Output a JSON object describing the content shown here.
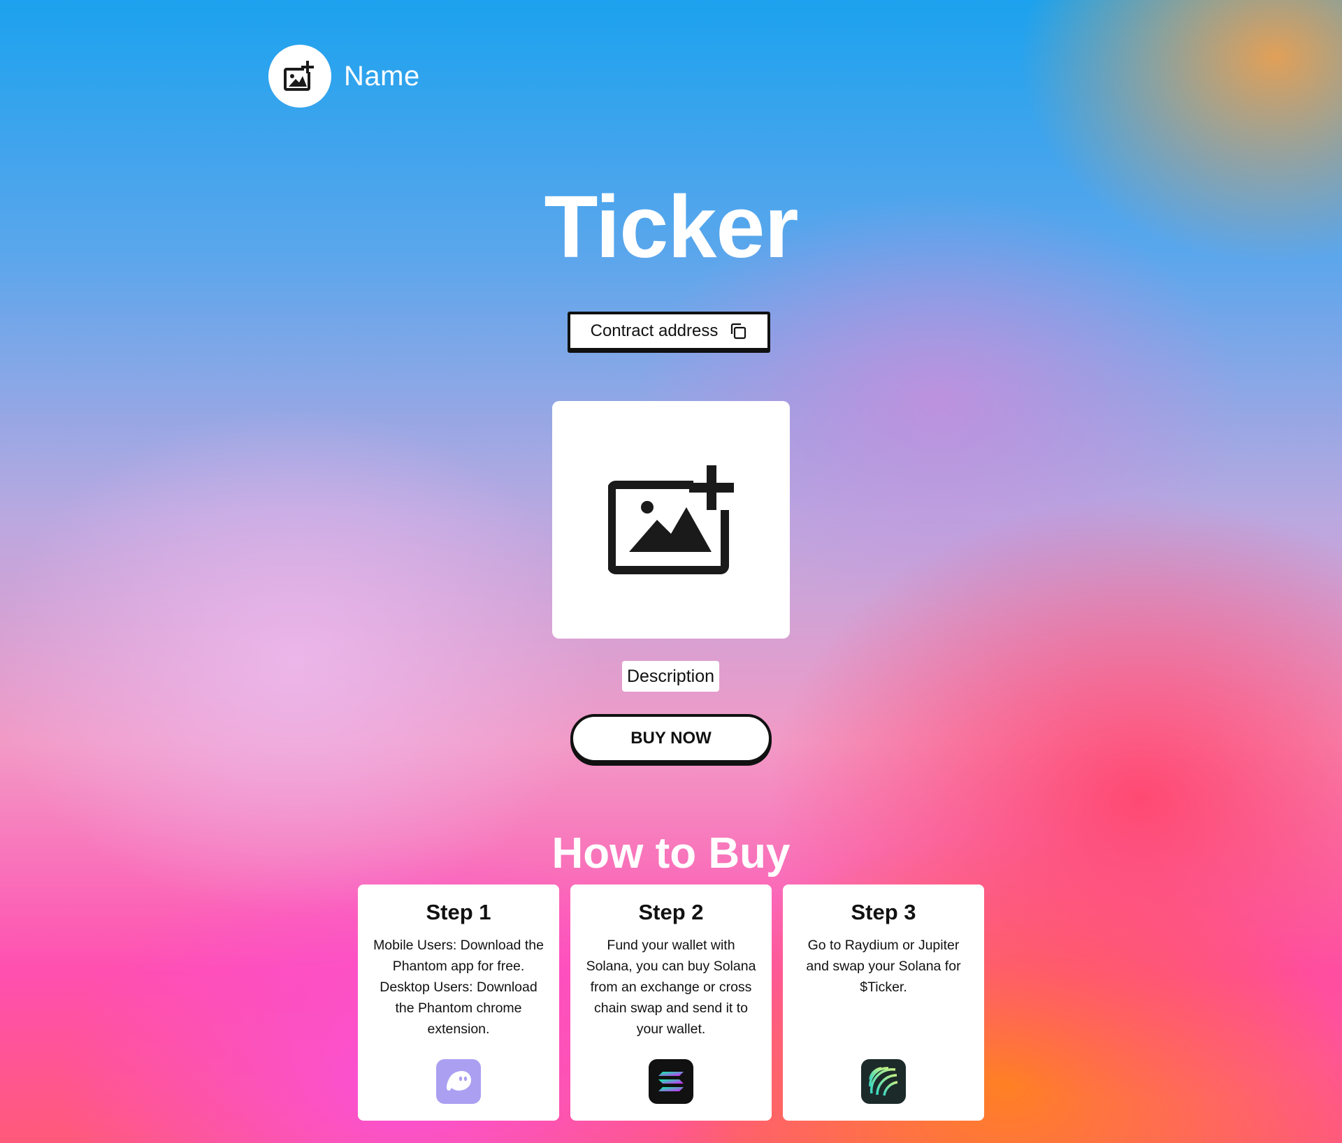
{
  "header": {
    "logo_icon": "add-image-icon",
    "site_name": "Name"
  },
  "hero": {
    "title": "Ticker",
    "contract_label": "Contract address",
    "contract_icon": "copy-icon",
    "image_icon": "add-image-icon",
    "description": "Description",
    "buy_label": "BUY NOW"
  },
  "how_to_buy": {
    "title": "How to Buy",
    "steps": [
      {
        "title": "Step 1",
        "text": "Mobile Users: Download the Phantom app for free. Desktop Users: Download the Phantom chrome extension.",
        "icon": "phantom-icon",
        "icon_color": "#ab9ff2"
      },
      {
        "title": "Step 2",
        "text": "Fund your wallet with Solana, you can buy Solana from an exchange or cross chain swap and send it to your wallet.",
        "icon": "solana-icon",
        "icon_color": "#111111"
      },
      {
        "title": "Step 3",
        "text": "Go to Raydium or Jupiter and swap your Solana for $Ticker.",
        "icon": "jupiter-icon",
        "icon_color": "#1c2b2a"
      }
    ]
  },
  "colors": {
    "text_dark": "#111111",
    "white": "#ffffff"
  }
}
